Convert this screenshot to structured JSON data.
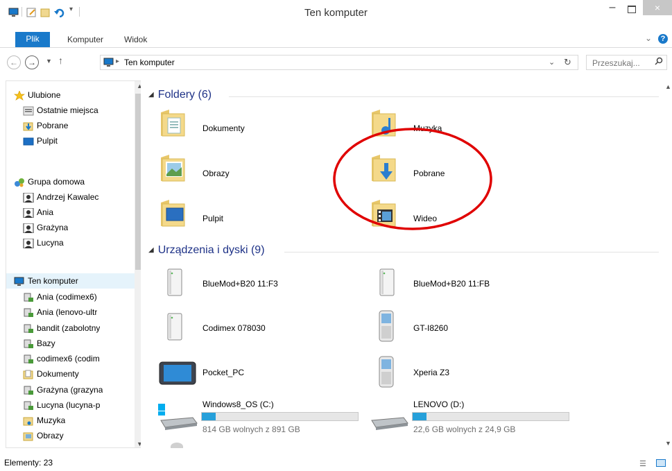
{
  "window": {
    "title": "Ten komputer",
    "minimize": "–",
    "close": "×"
  },
  "ribbon": {
    "tabs": [
      "Plik",
      "Komputer",
      "Widok"
    ],
    "help": "?"
  },
  "address": {
    "path": "Ten komputer",
    "search_placeholder": "Przeszukaj..."
  },
  "nav": {
    "favorites": [
      "Ulubione",
      "Ostatnie miejsca",
      "Pobrane",
      "Pulpit"
    ],
    "homegroup": [
      "Grupa domowa",
      "Andrzej Kawalec",
      "Ania",
      "Grażyna",
      "Lucyna"
    ],
    "computer": [
      "Ten komputer",
      "Ania (codimex6)",
      "Ania (lenovo-ultr",
      "bandit (zabolotny",
      "Bazy",
      "codimex6 (codim",
      "Dokumenty",
      "Grażyna (grazyna",
      "Lucyna (lucyna-p",
      "Muzyka",
      "Obrazy"
    ]
  },
  "content": {
    "folders_header": "Foldery (6)",
    "folders": [
      "Dokumenty",
      "Muzyka",
      "Obrazy",
      "Pobrane",
      "Pulpit",
      "Wideo"
    ],
    "devices_header": "Urządzenia i dyski (9)",
    "devices": [
      "BlueMod+B20 11:F3",
      "BlueMod+B20 11:FB",
      "Codimex 078030",
      "GT-I8260",
      "Pocket_PC",
      "Xperia Z3"
    ],
    "drives": [
      {
        "name": "Windows8_OS (C:)",
        "free": "814 GB wolnych z 891 GB",
        "used_fraction": 0.09
      },
      {
        "name": "LENOVO (D:)",
        "free": "22,6 GB wolnych z 24,9 GB",
        "used_fraction": 0.09
      }
    ]
  },
  "status": {
    "text": "Elementy: 23"
  },
  "colors": {
    "accent": "#1979ca",
    "header": "#1e3287",
    "annotation": "#e00000",
    "bar_fill": "#26a0da"
  }
}
